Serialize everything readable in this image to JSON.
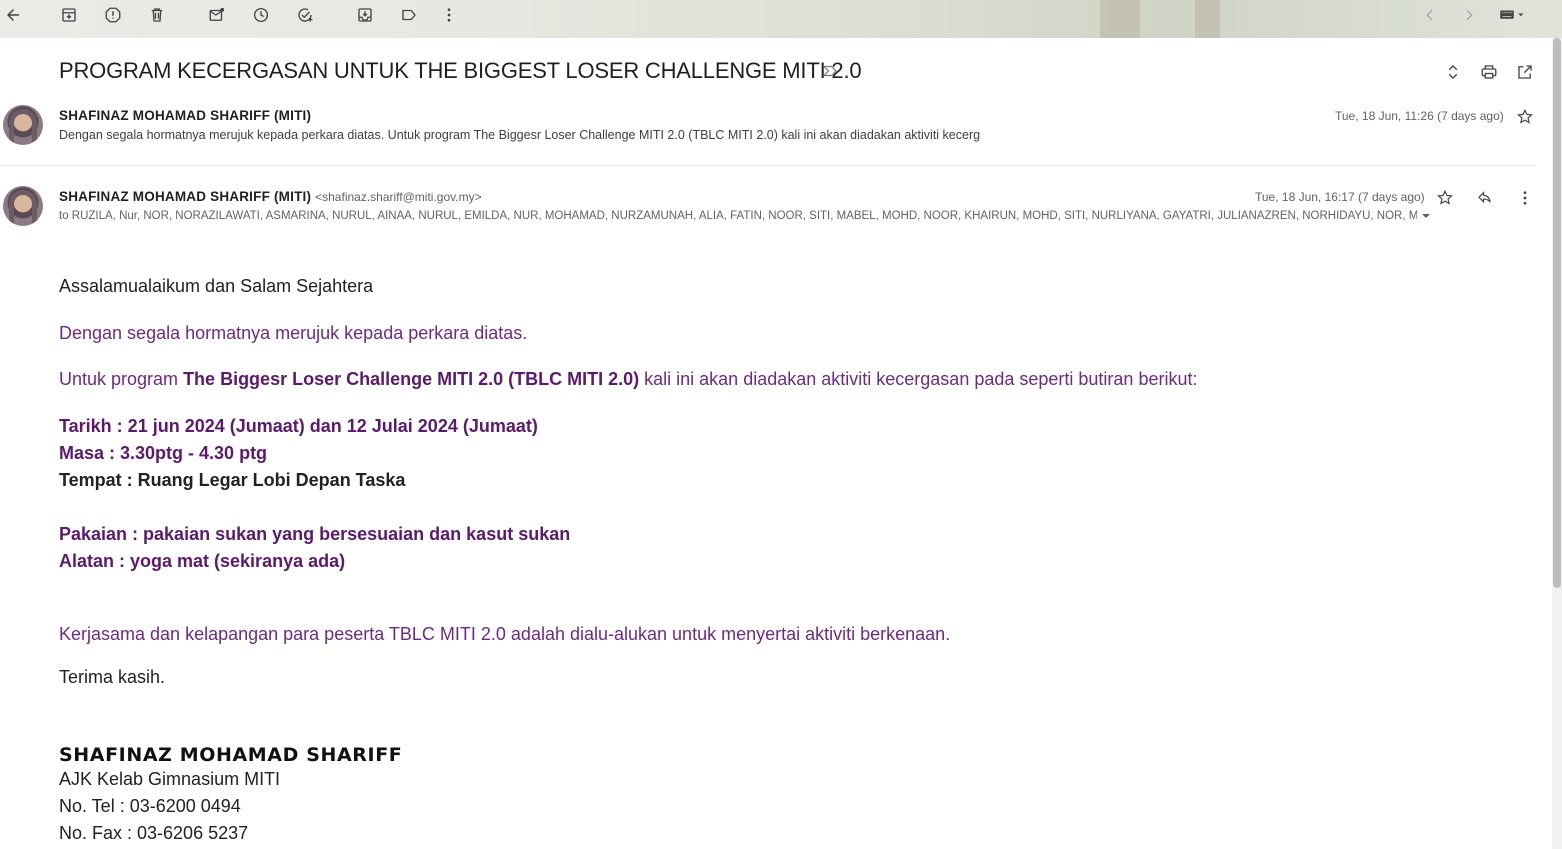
{
  "colors": {
    "accent_purple": "#5b1a6e",
    "text_dark": "#202124",
    "meta_gray": "#5f6368"
  },
  "toolbar": {
    "icons": [
      "back-arrow-icon",
      "archive-icon",
      "report-spam-icon",
      "delete-icon",
      "mark-unread-icon",
      "snooze-icon",
      "add-to-tasks-icon",
      "move-to-icon",
      "label-icon",
      "more-vert-icon",
      "prev-chevron-icon",
      "next-chevron-icon",
      "keyboard-icon"
    ]
  },
  "email": {
    "subject": "PROGRAM KECERGASAN UNTUK THE BIGGEST LOSER CHALLENGE MITI 2.0",
    "collapsed": {
      "sender": "SHAFINAZ MOHAMAD SHARIFF (MITI)",
      "date": "Tue, 18 Jun, 11:26 (7 days ago)",
      "snippet": "Dengan segala hormatnya merujuk kepada perkara diatas. Untuk program The Biggesr Loser Challenge MITI 2.0 (TBLC MITI 2.0) kali ini akan diadakan aktiviti kecerg"
    },
    "expanded": {
      "sender": "SHAFINAZ MOHAMAD SHARIFF (MITI)",
      "email": "<shafinaz.shariff@miti.gov.my>",
      "date": "Tue, 18 Jun, 16:17 (7 days ago)",
      "to": "to RUZILA, Nur, NOR, NORAZILAWATI, ASMARINA, NURUL, AINAA, NURUL, EMILDA, NUR, MOHAMAD, NURZAMUNAH, ALIA, FATIN, NOOR, SITI, MABEL, MOHD, NOOR, KHAIRUN, MOHD, SITI, NURLIYANA, GAYATRI, JULIANAZREN, NORHIDAYU, NOR, MUH"
    },
    "body": {
      "greeting": "Assalamualaikum dan Salam Sejahtera",
      "line1": "Dengan segala hormatnya merujuk kepada perkara diatas.",
      "line2_pre": "Untuk program ",
      "line2_bold": "The Biggesr Loser Challenge MITI 2.0 (TBLC MITI 2.0)",
      "line2_post": " kali ini akan diadakan aktiviti kecergasan pada seperti butiran berikut:",
      "tarikh": "Tarikh : 21 jun 2024 (Jumaat) dan 12 Julai 2024 (Jumaat)",
      "masa": "Masa : 3.30ptg - 4.30 ptg",
      "tempat": "Tempat : Ruang Legar Lobi Depan Taska",
      "pakaian": "Pakaian : pakaian sukan yang bersesuaian dan kasut sukan",
      "alatan": "Alatan : yoga mat (sekiranya ada)",
      "kerjasama": "Kerjasama dan kelapangan para peserta TBLC MITI 2.0 adalah dialu-alukan untuk menyertai aktiviti berkenaan.",
      "thanks": "Terima kasih."
    },
    "signature": {
      "name": "SHAFINAZ MOHAMAD SHARIFF",
      "title": "AJK Kelab Gimnasium MITI",
      "tel": "No. Tel : 03-6200 0494",
      "fax": "No. Fax : 03-6206 5237"
    }
  }
}
